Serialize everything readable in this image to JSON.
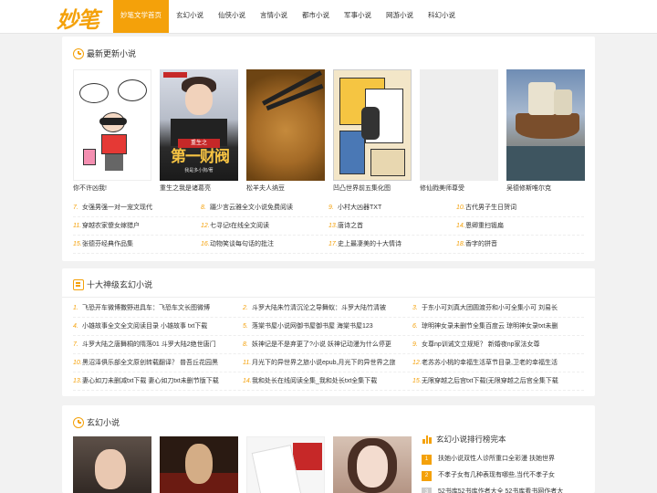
{
  "header": {
    "logo": "妙笔",
    "nav": [
      "妙笔文学首页",
      "玄幻小说",
      "仙侠小说",
      "言情小说",
      "都市小说",
      "军事小说",
      "网游小说",
      "科幻小说"
    ]
  },
  "latest": {
    "title": "最新更新小说",
    "books": [
      {
        "title": "你不许凶我!",
        "bubble_left": "要要奶奶你好!我该不该死了!",
        "bubble_right": "再一位哦、!我会都的!"
      },
      {
        "title": "重生之我是诸葛亮",
        "tag": "",
        "cover_line1": "重生之",
        "cover_line2": "第一财阀",
        "cover_author": "我是多小狗/著"
      },
      {
        "title": "松羊夫人纳豆"
      },
      {
        "title": "凹凸世界前五集化图"
      },
      {
        "title": "修仙戮美师尊受"
      },
      {
        "title": "吴德修斯唯尔克"
      }
    ],
    "list": [
      [
        {
          "n": "7.",
          "t": "女强男强一对一宠文现代"
        },
        {
          "n": "8.",
          "t": "蹑少言云雅全文小说免费阅读"
        },
        {
          "n": "9.",
          "t": "小村大凶器TXT"
        },
        {
          "n": "10.",
          "t": "古代男子生日贺词"
        }
      ],
      [
        {
          "n": "11.",
          "t": "穿越农家傻女嫁猎户"
        },
        {
          "n": "12.",
          "t": "七寻记t在线全文阅读"
        },
        {
          "n": "13.",
          "t": "唐诗之首"
        },
        {
          "n": "14.",
          "t": "恩卿重扫锻扁"
        }
      ],
      [
        {
          "n": "15.",
          "t": "张德芬经典作品集"
        },
        {
          "n": "16.",
          "t": "动物笑谈每句话的批注"
        },
        {
          "n": "17.",
          "t": "史上最凄美的十大情诗"
        },
        {
          "n": "18.",
          "t": "香字的拼音"
        }
      ]
    ]
  },
  "top10": {
    "title": "十大神级玄幻小说",
    "list": [
      [
        {
          "n": "1.",
          "t": "飞恐开车微博撒野进具车：飞恐车文长图微博"
        },
        {
          "n": "2.",
          "t": "斗罗大陆朱竹清沉沦之导舞蚁：斗罗大陆竹清被"
        },
        {
          "n": "3.",
          "t": "于东小可刘真大团圆渡芬和小可全集小可 刘易长"
        }
      ],
      [
        {
          "n": "4.",
          "t": "小雄故事全文全文阅读目录 小雄故事 txt下载"
        },
        {
          "n": "5.",
          "t": "落棠书屋小说网御书屋御书屋 海棠书屋123"
        },
        {
          "n": "6.",
          "t": "琼明神女录未删节全集百度云 琼明神女录txt未删"
        }
      ],
      [
        {
          "n": "7.",
          "t": "斗罗大陆之唐舞桐的隋落01 斗罗大陆2绝世唐门"
        },
        {
          "n": "8.",
          "t": "妖神记是不是弃更了?小说 妖神记动漫为什么停更"
        },
        {
          "n": "9.",
          "t": "女尊np训诫文立规矩？ 新婚夜np家法女尊"
        }
      ],
      [
        {
          "n": "10.",
          "t": "黑沼泽俱乐部全文原创转载翻译？ 普吾丘花园黑"
        },
        {
          "n": "11.",
          "t": "月光下的异世界之旅小说epub,月光下的异世界之旅"
        },
        {
          "n": "12.",
          "t": "老苏苏小桃的幸福生活草节目录,卫老的幸福生活"
        }
      ],
      [
        {
          "n": "13.",
          "t": "妻心如刀未删减txt下载 妻心如刀txt未删节版下载"
        },
        {
          "n": "14.",
          "t": "我和处长在线阅读全集_我和处长txt全集下载"
        },
        {
          "n": "15.",
          "t": "无限穿越之后宫txt下载(无限穿越之后宫全集下载"
        }
      ]
    ]
  },
  "fantasy": {
    "title": "玄幻小说",
    "rank_title": "玄幻小说排行榜完本",
    "rank": [
      {
        "n": "1",
        "t": "扶她小说双性人诊所重口全彩漫 扶她世界"
      },
      {
        "n": "2",
        "t": "不孝子女有几种表现有哪些,当代不孝子女"
      },
      {
        "n": "3",
        "t": "52书库52书库作者大全 52书库看书网作者大"
      }
    ]
  },
  "colors": {
    "accent": "#f4a10a",
    "background": "#f2f2f2"
  }
}
